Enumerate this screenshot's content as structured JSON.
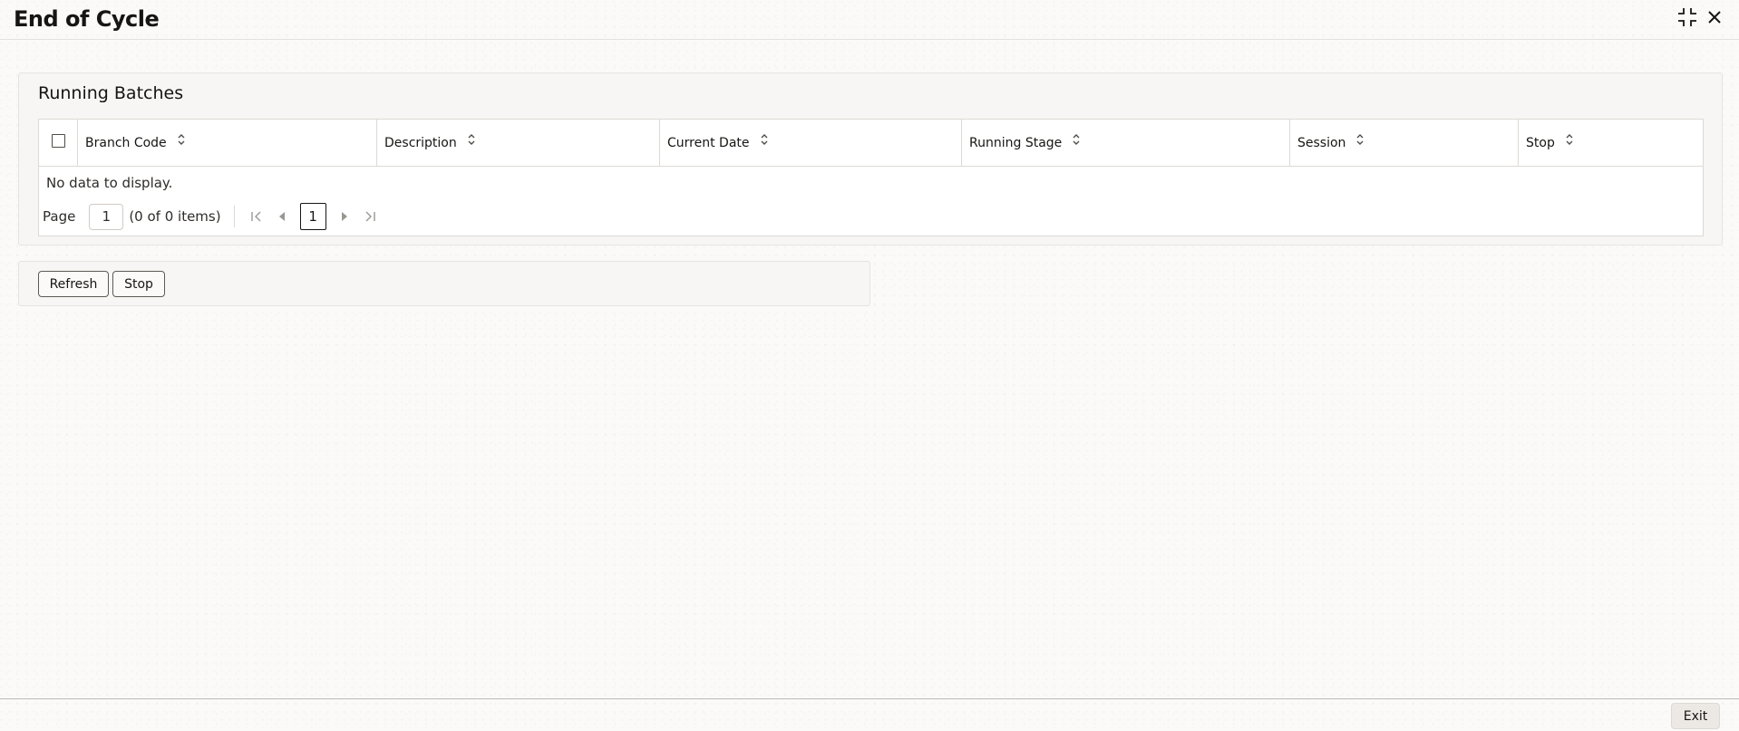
{
  "window": {
    "title": "End of Cycle",
    "minimize_icon": "collapse-icon",
    "close_icon": "close-icon"
  },
  "running_batches": {
    "title": "Running Batches",
    "columns": [
      "Branch Code",
      "Description",
      "Current Date",
      "Running Stage",
      "Session",
      "Stop"
    ],
    "rows": [],
    "empty_message": "No data to display.",
    "pagination": {
      "page_label": "Page",
      "page_value": "1",
      "items_summary": "(0 of 0 items)",
      "current_page": "1"
    }
  },
  "actions": {
    "refresh_label": "Refresh",
    "stop_label": "Stop"
  },
  "footer": {
    "exit_label": "Exit"
  },
  "colors": {
    "text": "#161513",
    "background": "#fbfaf8",
    "border": "#dcdad6"
  }
}
